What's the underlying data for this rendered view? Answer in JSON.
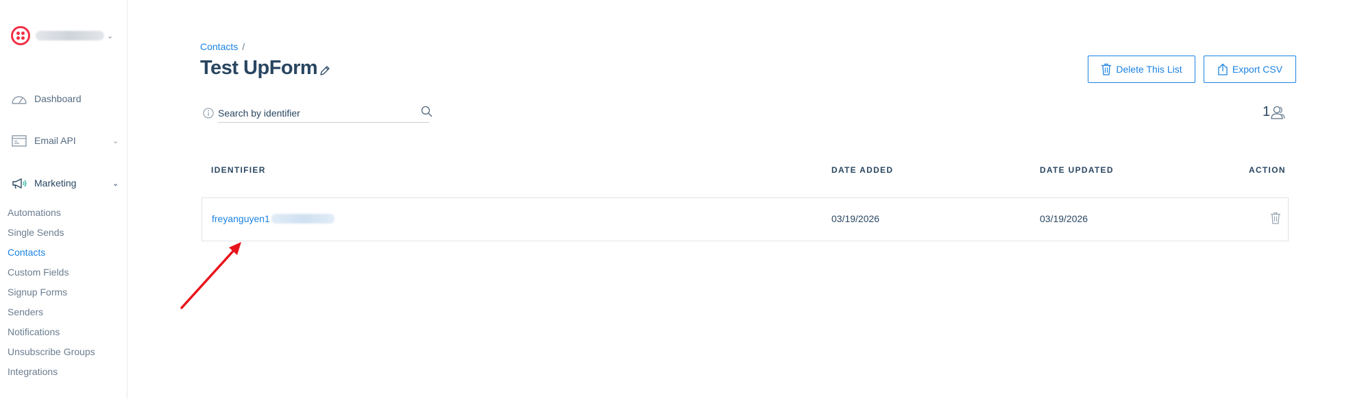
{
  "sidebar": {
    "nav": [
      {
        "label": "Dashboard",
        "icon": "dashboard-gauge-icon"
      },
      {
        "label": "Email API",
        "icon": "email-api-icon"
      },
      {
        "label": "Marketing",
        "icon": "megaphone-icon"
      }
    ],
    "marketing_items": [
      {
        "label": "Automations"
      },
      {
        "label": "Single Sends"
      },
      {
        "label": "Contacts",
        "active": true
      },
      {
        "label": "Custom Fields"
      },
      {
        "label": "Signup Forms"
      },
      {
        "label": "Senders"
      },
      {
        "label": "Notifications"
      },
      {
        "label": "Unsubscribe Groups"
      },
      {
        "label": "Integrations"
      }
    ]
  },
  "breadcrumb": {
    "parent": "Contacts",
    "separator": "/"
  },
  "page": {
    "title": "Test UpForm"
  },
  "actions": {
    "delete_label": "Delete This List",
    "export_label": "Export CSV"
  },
  "search": {
    "placeholder": "Search by identifier",
    "value": ""
  },
  "contact_count": "1",
  "table": {
    "headers": [
      "IDENTIFIER",
      "DATE ADDED",
      "DATE UPDATED",
      "ACTION"
    ],
    "rows": [
      {
        "identifier": "freyanguyen1",
        "date_added": "03/19/2026",
        "date_updated": "03/19/2026"
      }
    ]
  },
  "colors": {
    "accent": "#1a82e2",
    "brand_red": "#f22f46",
    "text": "#294661",
    "annotation_arrow": "#e8141c"
  }
}
